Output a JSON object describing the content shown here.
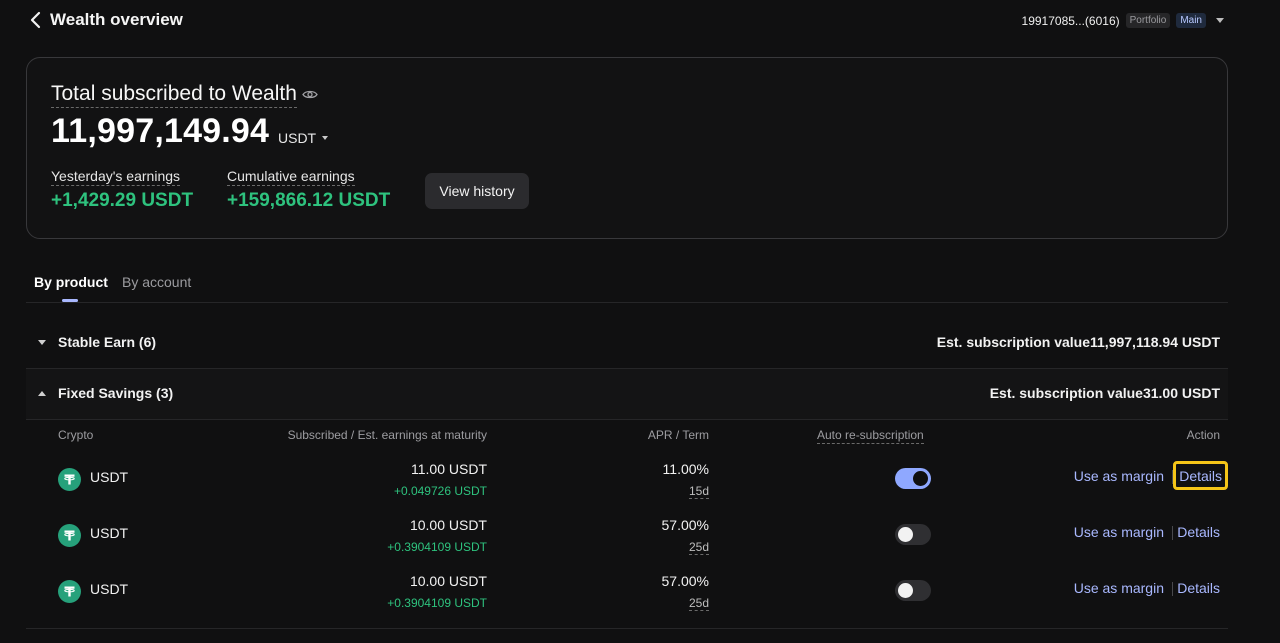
{
  "header": {
    "title": "Wealth overview",
    "account_id": "19917085...(6016)",
    "badge_portfolio": "Portfolio",
    "badge_main": "Main"
  },
  "summary": {
    "title": "Total subscribed to Wealth",
    "total": "11,997,149.94",
    "currency": "USDT",
    "yesterday_label": "Yesterday's earnings",
    "yesterday_value": "+1,429.29 USDT",
    "cumulative_label": "Cumulative earnings",
    "cumulative_value": "+159,866.12 USDT",
    "view_history_label": "View history"
  },
  "tabs": [
    {
      "label": "By product",
      "active": true
    },
    {
      "label": "By account",
      "active": false
    }
  ],
  "groups": [
    {
      "name": "Stable Earn (6)",
      "est": "Est. subscription value11,997,118.94 USDT",
      "expanded": false
    },
    {
      "name": "Fixed Savings (3)",
      "est": "Est. subscription value31.00 USDT",
      "expanded": true
    }
  ],
  "table": {
    "headers": {
      "crypto": "Crypto",
      "subscribed": "Subscribed / Est. earnings at maturity",
      "apr": "APR / Term",
      "auto": "Auto re-subscription",
      "action": "Action"
    },
    "rows": [
      {
        "coin": "USDT",
        "subscribed": "11.00 USDT",
        "est": "+0.049726 USDT",
        "apr": "11.00%",
        "term": "15d",
        "auto": true,
        "margin": "Use as margin",
        "details": "Details"
      },
      {
        "coin": "USDT",
        "subscribed": "10.00 USDT",
        "est": "+0.3904109 USDT",
        "apr": "57.00%",
        "term": "25d",
        "auto": false,
        "margin": "Use as margin",
        "details": "Details"
      },
      {
        "coin": "USDT",
        "subscribed": "10.00 USDT",
        "est": "+0.3904109 USDT",
        "apr": "57.00%",
        "term": "25d",
        "auto": false,
        "margin": "Use as margin",
        "details": "Details"
      }
    ]
  },
  "icons": {
    "back": "chevron-left-icon",
    "eye": "eye-icon",
    "coin": "tether-usdt-icon"
  },
  "colors": {
    "background": "#101011",
    "positive": "#2ec27e",
    "accent": "#a9b8ff",
    "toggle_on": "#8fa8ff",
    "highlight": "#f5c518",
    "tether": "#26a17b"
  }
}
